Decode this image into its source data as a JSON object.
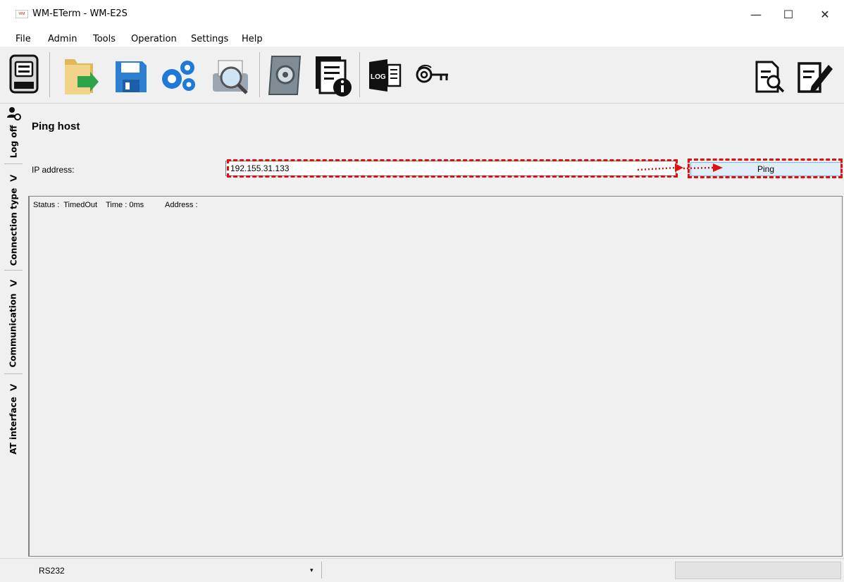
{
  "window": {
    "title": "WM-ETerm - WM-E2S",
    "app_icon_text": "WM",
    "controls": {
      "minimize": "—",
      "maximize": "☐",
      "close": "✕"
    }
  },
  "menu": {
    "items": [
      "File",
      "Admin",
      "Tools",
      "Operation",
      "Settings",
      "Help"
    ]
  },
  "toolbar": {
    "buttons": [
      "meter-icon",
      "open-folder-icon",
      "save-icon",
      "settings-gears-icon",
      "preview-icon",
      "config-book-icon",
      "info-document-icon",
      "log-icon",
      "key-icon",
      "document-search-icon",
      "edit-document-icon"
    ],
    "log_label": "LOG"
  },
  "sidebar": {
    "tabs": [
      "Log off",
      "Connection type",
      "Communication",
      "AT interface"
    ]
  },
  "ping": {
    "title": "Ping host",
    "ip_label": "IP address:",
    "ip_value": "192.155.31.133",
    "button_label": "Ping",
    "result": "Status :  TimedOut    Time : 0ms          Address :"
  },
  "statusbar": {
    "connection": "RS232",
    "dropdown_arrow": "▾"
  },
  "colors": {
    "highlight": "#e01010",
    "button_bg": "#e1edf7",
    "panel_bg": "#f0f0f0"
  }
}
